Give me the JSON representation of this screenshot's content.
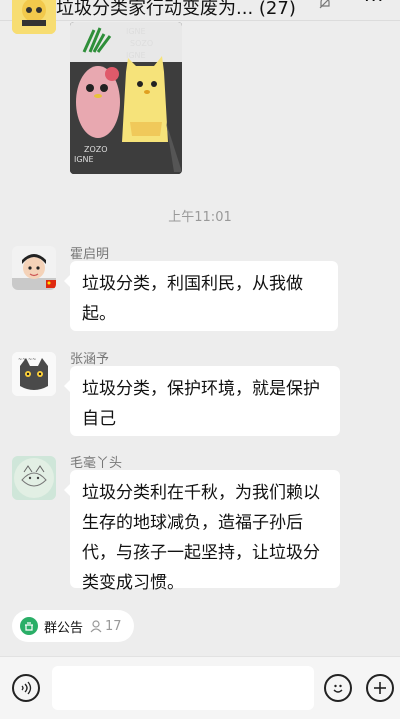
{
  "header": {
    "back_icon": "chevron-left-icon",
    "title": "垃圾分类家行动变废为...",
    "count": "(27)",
    "mute_icon": "bell-off-icon",
    "more_icon": "more-dots-icon"
  },
  "messages": [
    {
      "type": "image",
      "description_icon": "photo"
    },
    {
      "type": "time",
      "text": "上午11:01"
    },
    {
      "type": "text",
      "name": "霍启明",
      "text": "垃圾分类，利国利民，从我做起。"
    },
    {
      "type": "text",
      "name": "张涵予",
      "text": "垃圾分类，保护环境，就是保护自己"
    },
    {
      "type": "text",
      "name": "毛毫丫头",
      "text": "垃圾分类利在千秋，为我们赖以生存的地球减负，造福子孙后代，与孩子一起坚持，让垃圾分类变成习惯。"
    }
  ],
  "notice": {
    "label": "群公告",
    "count": "17"
  },
  "input": {
    "placeholder": ""
  },
  "colors": {
    "background": "#ededed",
    "notice_green": "#2aae67"
  }
}
